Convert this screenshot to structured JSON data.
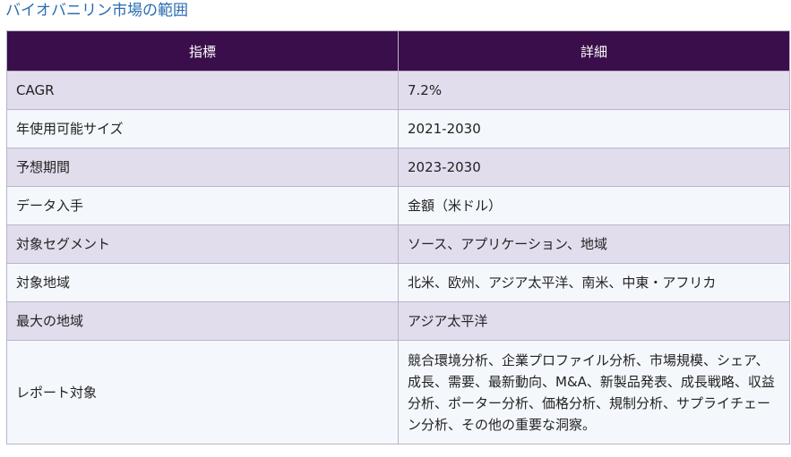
{
  "title": "バイオバニリン市場の範囲",
  "table": {
    "headers": [
      "指標",
      "詳細"
    ],
    "rows": [
      {
        "label": "CAGR",
        "value": "7.2%"
      },
      {
        "label": "年使用可能サイズ",
        "value": "2021-2030"
      },
      {
        "label": "予想期間",
        "value": "2023-2030"
      },
      {
        "label": "データ入手",
        "value": "金額（米ドル）"
      },
      {
        "label": "対象セグメント",
        "value": "ソース、アプリケーション、地域"
      },
      {
        "label": "対象地域",
        "value": "北米、欧州、アジア太平洋、南米、中東・アフリカ"
      },
      {
        "label": "最大の地域",
        "value": "アジア太平洋"
      },
      {
        "label": "レポート対象",
        "value": "競合環境分析、企業プロファイル分析、市場規模、シェア、成長、需要、最新動向、M&A、新製品発表、成長戦略、収益分析、ポーター分析、価格分析、規制分析、サプライチェーン分析、その他の重要な洞察。"
      }
    ]
  }
}
